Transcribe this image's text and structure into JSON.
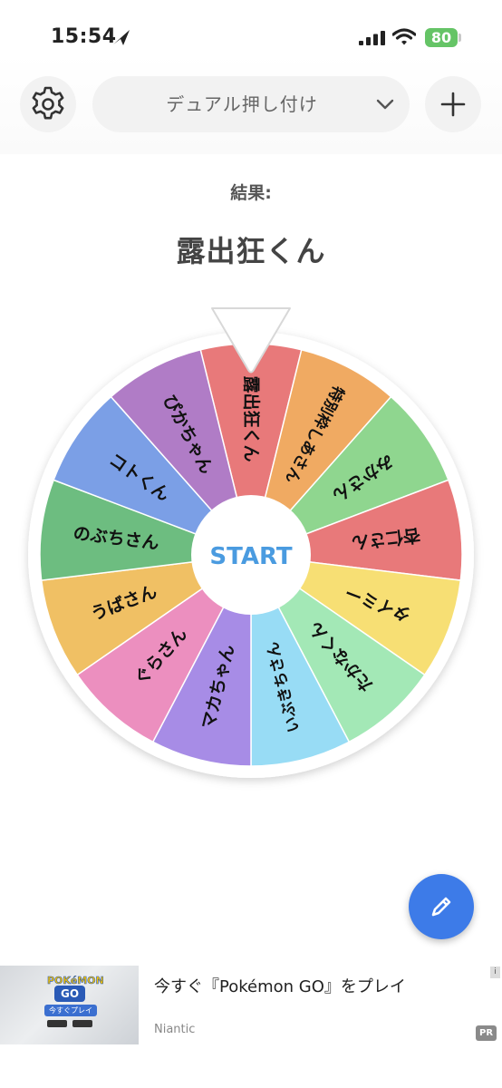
{
  "status_bar": {
    "time": "15:54",
    "battery": "80"
  },
  "header": {
    "wheel_name": "デュアル押し付け"
  },
  "result": {
    "label": "結果:",
    "value": "露出狂くん"
  },
  "wheel": {
    "start_label": "START",
    "start_color": "#4a9be0",
    "segments": [
      {
        "label": "露出狂くん",
        "color": "#e8797a"
      },
      {
        "label": "特別枠しあさん",
        "color": "#f0aa62"
      },
      {
        "label": "みかさん",
        "color": "#8fd68f"
      },
      {
        "label": "杏仁さん",
        "color": "#e8797a"
      },
      {
        "label": "タイミー",
        "color": "#f7df74"
      },
      {
        "label": "たかなくん",
        "color": "#a3e8b6"
      },
      {
        "label": "いぶきちさん",
        "color": "#98dcf5"
      },
      {
        "label": "マカちゃん",
        "color": "#a78ce6"
      },
      {
        "label": "ぐらさん",
        "color": "#ec8fbf"
      },
      {
        "label": "うばさん",
        "color": "#f0c064"
      },
      {
        "label": "のぶちさん",
        "color": "#6dbd80"
      },
      {
        "label": "コトくん",
        "color": "#7b9fe6"
      },
      {
        "label": "ぴかちゃん",
        "color": "#b07cc6"
      }
    ]
  },
  "ad": {
    "title": "今すぐ『Pokémon GO』をプレイ",
    "advertiser": "Niantic",
    "badge": "PR",
    "thumb_logo": "POKéMON",
    "thumb_go": "GO",
    "thumb_button": "今すぐプレイ"
  }
}
